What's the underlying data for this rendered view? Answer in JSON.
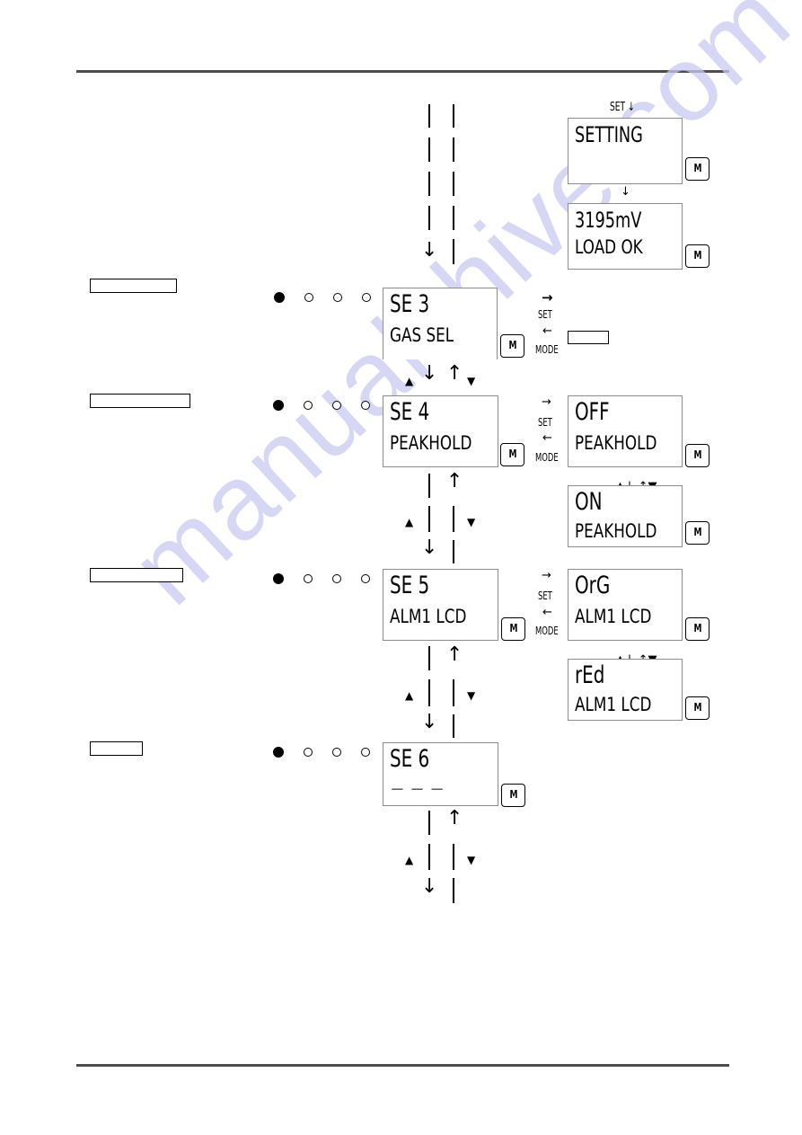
{
  "watermark": "manualshive.com",
  "top_flow": {
    "set_label": "SET ↓",
    "setting_screen": {
      "line1": "SETTING",
      "line2": ""
    },
    "connector_arrow": "↓",
    "load_screen": {
      "line1": "3195mV",
      "line2": "LOAD OK"
    }
  },
  "buttons": {
    "m_label": "M"
  },
  "glyphs": {
    "arrow_down": "↓",
    "arrow_up": "↑",
    "arrow_right": "→",
    "arrow_left": "←",
    "tri_up": "▲",
    "tri_down": "▼",
    "set": "SET",
    "mode": "MODE",
    "toggle_row": "▲↓ ↑▼"
  },
  "steps": [
    {
      "id": "SE3",
      "line1": "SE 3",
      "line2": "GAS SEL",
      "indicator": [
        true,
        false,
        false,
        false
      ]
    },
    {
      "id": "SE4",
      "line1": "SE 4",
      "line2": "PEAKHOLD",
      "indicator": [
        true,
        false,
        false,
        false
      ],
      "options": [
        {
          "line1": "OFF",
          "line2": "PEAKHOLD"
        },
        {
          "line1": "ON",
          "line2": "PEAKHOLD"
        }
      ]
    },
    {
      "id": "SE5",
      "line1": "SE 5",
      "line2": "ALM1 LCD",
      "indicator": [
        true,
        false,
        false,
        false
      ],
      "options": [
        {
          "line1": "OrG",
          "line2": "ALM1 LCD"
        },
        {
          "line1": "rEd",
          "line2": "ALM1 LCD"
        }
      ]
    },
    {
      "id": "SE6",
      "line1": "SE 6",
      "line2": "－ － －",
      "indicator": [
        true,
        false,
        false,
        false
      ]
    }
  ]
}
